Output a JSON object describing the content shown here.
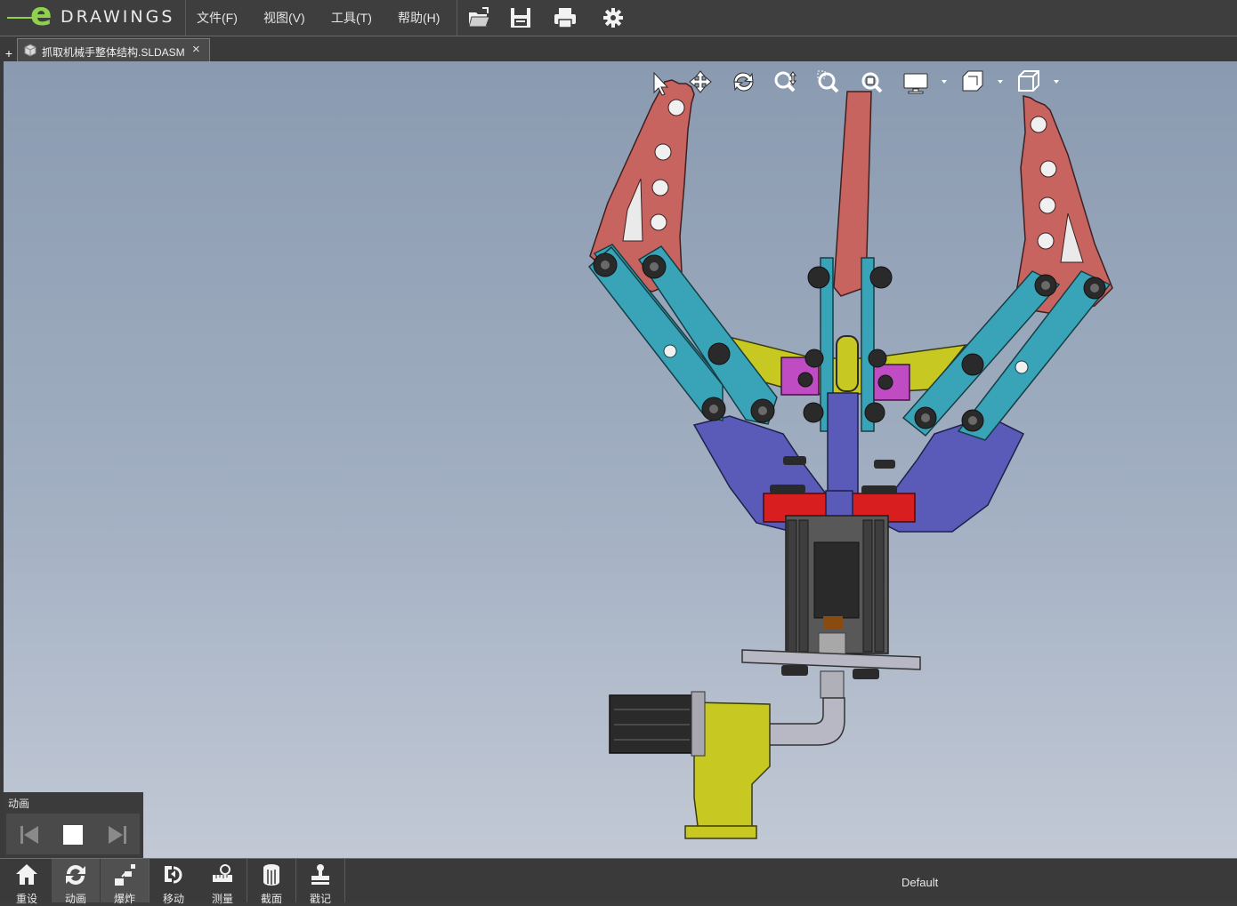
{
  "app": {
    "logo_text": "DRAWINGS",
    "logo_mark": "e"
  },
  "menu": {
    "file": "文件(F)",
    "view": "视图(V)",
    "tools": "工具(T)",
    "help": "帮助(H)"
  },
  "toolbar": {
    "icons": [
      "open-icon",
      "save-icon",
      "print-icon",
      "settings-gear-icon"
    ]
  },
  "tab": {
    "new_tab": "+",
    "document": "抓取机械手整体结构.SLDASM",
    "close": "×"
  },
  "view_toolbar": {
    "icons": [
      "select-arrow-icon",
      "pan-icon",
      "rotate-icon",
      "zoom-icon",
      "zoom-to-area-icon",
      "zoom-to-fit-icon",
      "display-style-icon",
      "shading-icon",
      "standard-views-icon"
    ]
  },
  "animation_panel": {
    "title": "动画",
    "controls": [
      "previous-icon",
      "stop-icon",
      "next-icon"
    ]
  },
  "bottom_toolbar": {
    "items": [
      {
        "label": "重设",
        "icon": "home-icon"
      },
      {
        "label": "动画",
        "icon": "animate-icon",
        "active": true
      },
      {
        "label": "爆炸",
        "icon": "explode-icon",
        "active": true
      },
      {
        "label": "移动",
        "icon": "move-icon"
      },
      {
        "label": "测量",
        "icon": "measure-icon"
      },
      {
        "label": "截面",
        "icon": "section-icon"
      },
      {
        "label": "戳记",
        "icon": "stamp-icon"
      }
    ],
    "configuration": "Default"
  },
  "colors": {
    "arm_red": "#c86460",
    "link_teal": "#39a4b8",
    "base_purple": "#5a5ab8",
    "plate_red": "#d81e1e",
    "motor_yellow": "#b9b325",
    "pink_block": "#c04cc4"
  }
}
